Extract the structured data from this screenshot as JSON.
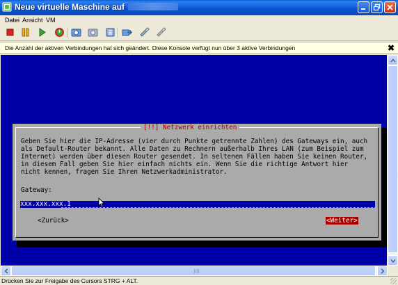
{
  "window": {
    "title": "Neue virtuelle Maschine auf",
    "icon": "vm-console-icon"
  },
  "menu": {
    "items": [
      "Datei",
      "Ansicht",
      "VM"
    ]
  },
  "toolbar": {
    "icons": [
      "stop-icon",
      "pause-icon",
      "play-icon",
      "reset-icon",
      "snapshot-icon",
      "revert-snapshot-icon",
      "manage-snapshots-icon",
      "migrate-icon",
      "settings-icon",
      "clone-icon"
    ]
  },
  "info_bar": {
    "message": "Die Anzahl der aktiven Verbindungen hat sich geändert. Diese Konsole verfügt nun über 3 aktive Verbindungen",
    "close": "✖"
  },
  "console": {
    "background": "#0000a8",
    "dialog": {
      "title": "[!!] Netzwerk einrichten",
      "body_lines": [
        "Geben Sie hier die IP-Adresse (vier durch Punkte getrennte Zahlen) des Gateways ein, auch",
        "als Default-Router bekannt. Alle Daten zu Rechnern außerhalb Ihres LAN (zum Beispiel zum",
        "Internet) werden über diesen Router gesendet. In seltenen Fällen haben Sie keinen Router,",
        "in diesem Fall geben Sie hier einfach nichts ein. Wenn Sie die richtige Antwort hier",
        "nicht kennen, fragen Sie Ihren Netzwerkadministrator."
      ],
      "field_label": "Gateway:",
      "field_value": "xxx.xxx.xxx.1",
      "back_button": "<Zurück>",
      "next_button": "<Weiter>",
      "title_color": "#a80000"
    }
  },
  "status_bar": {
    "text": "Drücken Sie zur Freigabe des Cursors STRG + ALT."
  }
}
